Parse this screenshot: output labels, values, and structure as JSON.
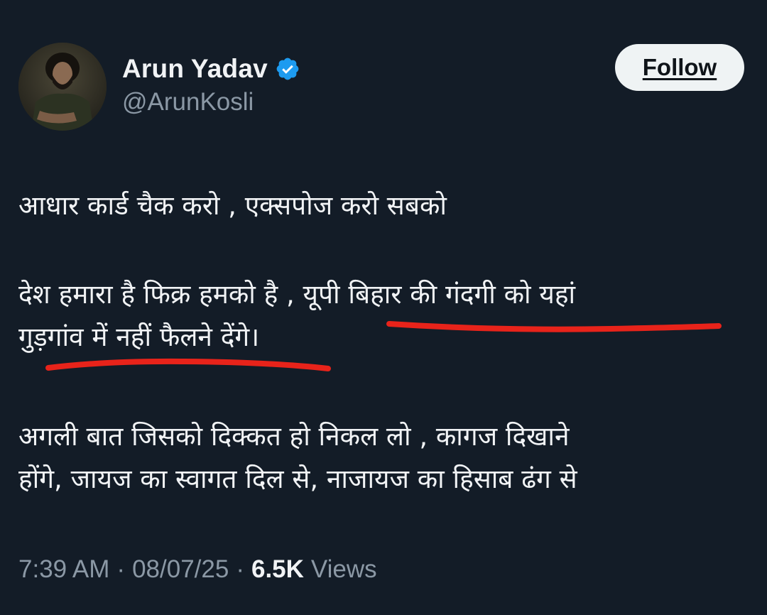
{
  "author": {
    "display_name": "Arun Yadav",
    "handle": "@ArunKosli",
    "verified_icon": "verified-badge-icon",
    "avatar_icon": "profile-photo"
  },
  "follow_button": {
    "label": "Follow"
  },
  "tweet": {
    "paragraph_1": "आधार कार्ड चैक करो , एक्सपोज करो सबको",
    "paragraph_2": "देश हमारा है फिक्र हमको है , यूपी बिहार की गंदगी को यहां\nगुड़गांव में नहीं फैलने देंगे।",
    "paragraph_3": "अगली बात जिसको दिक्कत हो निकल लो , कागज दिखाने\nहोंगे, जायज का स्वागत दिल से, नाजायज का हिसाब ढंग से"
  },
  "meta": {
    "time": "7:39 AM",
    "separator": "·",
    "date": "08/07/25",
    "views_count": "6.5K",
    "views_label": "Views"
  },
  "colors": {
    "background": "#131c27",
    "primary_text": "#f1f3f5",
    "secondary_text": "#8b98a5",
    "verified_blue": "#1d9bf0",
    "annotation_red": "#e8231a",
    "follow_bg": "#eff3f4"
  }
}
